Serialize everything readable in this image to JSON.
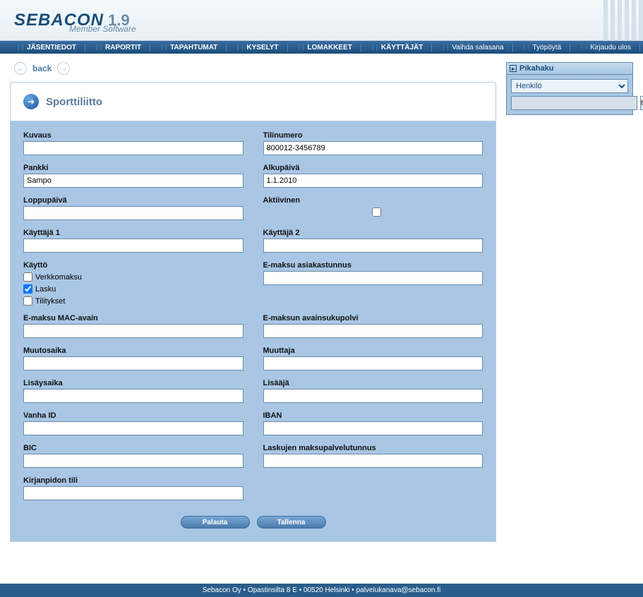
{
  "brand": {
    "name": "SEBACON",
    "version": "1.9",
    "subtitle": "Member Software"
  },
  "nav": {
    "left": [
      "JÄSENTIEDOT",
      "RAPORTIT",
      "TAPAHTUMAT",
      "KYSELYT",
      "LOMAKKEET",
      "KÄYTTÄJÄT"
    ],
    "right": [
      "Vaihda salasana",
      "Työpöytä",
      "Kirjaudu ulos"
    ]
  },
  "back": {
    "label": "back"
  },
  "page_title": "Sporttiliitto",
  "form": {
    "kuvaus": {
      "label": "Kuvaus",
      "value": ""
    },
    "tilinumero": {
      "label": "Tilinumero",
      "value": "800012-3456789"
    },
    "pankki": {
      "label": "Pankki",
      "value": "Sampo"
    },
    "alkupaiva": {
      "label": "Alkupäivä",
      "value": "1.1.2010"
    },
    "loppupaiva": {
      "label": "Loppupäivä",
      "value": ""
    },
    "aktiivinen": {
      "label": "Aktiivinen",
      "checked": false
    },
    "kayttaja1": {
      "label": "Käyttäjä 1",
      "value": ""
    },
    "kayttaja2": {
      "label": "Käyttäjä 2",
      "value": ""
    },
    "kaytto": {
      "label": "Käyttö",
      "options": [
        {
          "label": "Verkkomaksu",
          "checked": false
        },
        {
          "label": "Lasku",
          "checked": true
        },
        {
          "label": "Tilitykset",
          "checked": false
        }
      ]
    },
    "emaksu_asiakastunnus": {
      "label": "E-maksu asiakastunnus",
      "value": ""
    },
    "emaksu_mac": {
      "label": "E-maksu MAC-avain",
      "value": ""
    },
    "emaksu_sukupolvi": {
      "label": "E-maksun avainsukupolvi",
      "value": ""
    },
    "muutosaika": {
      "label": "Muutosaika",
      "value": ""
    },
    "muuttaja": {
      "label": "Muuttaja",
      "value": ""
    },
    "lisaysaika": {
      "label": "Lisäysaika",
      "value": ""
    },
    "lisaaja": {
      "label": "Lisääjä",
      "value": ""
    },
    "vanha_id": {
      "label": "Vanha ID",
      "value": ""
    },
    "iban": {
      "label": "IBAN",
      "value": ""
    },
    "bic": {
      "label": "BIC",
      "value": ""
    },
    "laskujen_mpt": {
      "label": "Laskujen maksupalvelutunnus",
      "value": ""
    },
    "kirjanpidon_tili": {
      "label": "Kirjanpidon tili",
      "value": ""
    }
  },
  "buttons": {
    "palauta": "Palauta",
    "tallenna": "Tallenna"
  },
  "quicksearch": {
    "title": "Pikahaku",
    "selected": "Henkilö",
    "button": "hae"
  },
  "footer": "Sebacon Oy • Opastinsilta 8 E • 00520 Helsinki • palvelukanava@sebacon.fi"
}
